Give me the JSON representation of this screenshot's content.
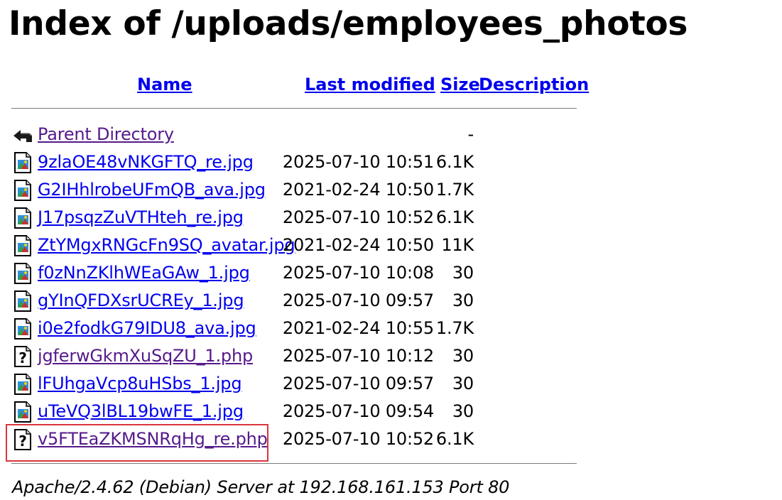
{
  "page": {
    "title": "Index of /uploads/employees_photos"
  },
  "columns": {
    "name": "Name",
    "last_modified": "Last modified",
    "size": "Size",
    "description": "Description"
  },
  "parent": {
    "label": "Parent Directory",
    "size": "-",
    "icon": "back-icon"
  },
  "files": [
    {
      "name": "9zlaOE48vNKGFTQ_re.jpg",
      "date": "2025-07-10 10:51",
      "size": "6.1K",
      "icon": "image-file-icon",
      "visited": false
    },
    {
      "name": "G2IHhlrobeUFmQB_ava.jpg",
      "date": "2021-02-24 10:50",
      "size": "1.7K",
      "icon": "image-file-icon",
      "visited": false
    },
    {
      "name": "J17psqzZuVTHteh_re.jpg",
      "date": "2025-07-10 10:52",
      "size": "6.1K",
      "icon": "image-file-icon",
      "visited": false
    },
    {
      "name": "ZtYMgxRNGcFn9SQ_avatar.jpg",
      "date": "2021-02-24 10:50",
      "size": "11K",
      "icon": "image-file-icon",
      "visited": false
    },
    {
      "name": "f0zNnZKlhWEaGAw_1.jpg",
      "date": "2025-07-10 10:08",
      "size": "30",
      "icon": "image-file-icon",
      "visited": false
    },
    {
      "name": "gYInQFDXsrUCREy_1.jpg",
      "date": "2025-07-10 09:57",
      "size": "30",
      "icon": "image-file-icon",
      "visited": false
    },
    {
      "name": "i0e2fodkG79IDU8_ava.jpg",
      "date": "2021-02-24 10:55",
      "size": "1.7K",
      "icon": "image-file-icon",
      "visited": false
    },
    {
      "name": "jgferwGkmXuSqZU_1.php",
      "date": "2025-07-10 10:12",
      "size": "30",
      "icon": "unknown-file-icon",
      "visited": true
    },
    {
      "name": "lFUhgaVcp8uHSbs_1.jpg",
      "date": "2025-07-10 09:57",
      "size": "30",
      "icon": "image-file-icon",
      "visited": false
    },
    {
      "name": "uTeVQ3lBL19bwFE_1.jpg",
      "date": "2025-07-10 09:54",
      "size": "30",
      "icon": "image-file-icon",
      "visited": false
    },
    {
      "name": "v5FTEaZKMSNRqHg_re.php",
      "date": "2025-07-10 10:52",
      "size": "6.1K",
      "icon": "unknown-file-icon",
      "visited": true,
      "highlighted": true
    }
  ],
  "footer": {
    "server": "Apache/2.4.62 (Debian) Server at 192.168.161.153 Port 80"
  },
  "colors": {
    "link": "#0000ee",
    "visited_link": "#551a8b",
    "highlight_border": "#d9363e",
    "rule": "#7a7a7a"
  }
}
